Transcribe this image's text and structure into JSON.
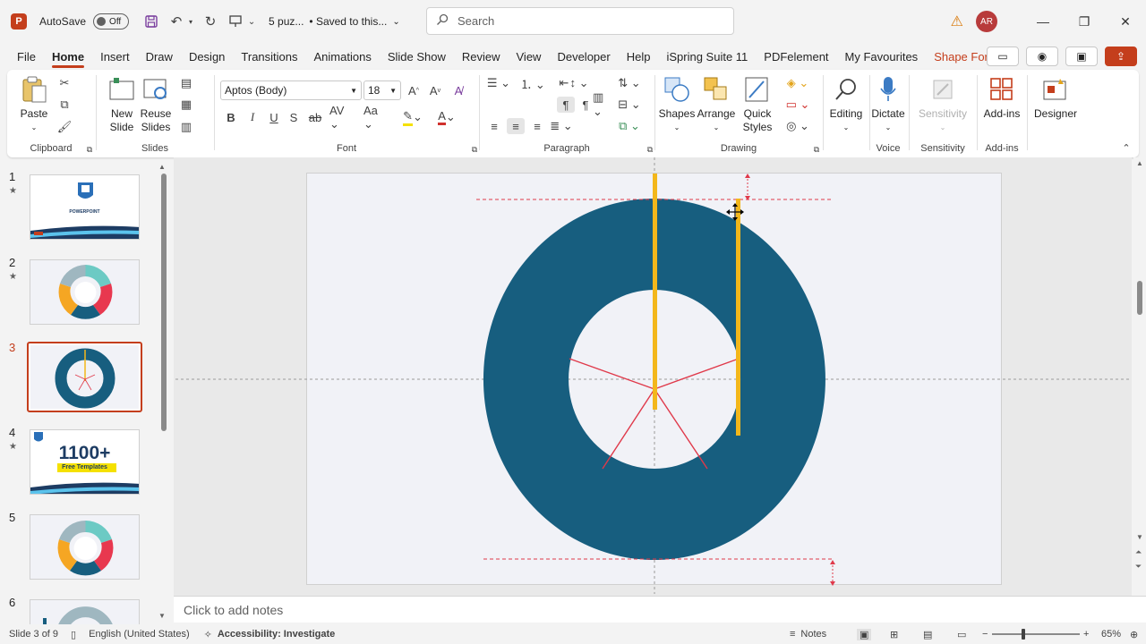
{
  "titlebar": {
    "app_logo": "P",
    "autosave_label": "AutoSave",
    "autosave_state": "Off",
    "doc_title": "5 puz...",
    "save_status": "• Saved to this...",
    "search_placeholder": "Search",
    "avatar_initials": "AR"
  },
  "menu": {
    "tabs": [
      "File",
      "Home",
      "Insert",
      "Draw",
      "Design",
      "Transitions",
      "Animations",
      "Slide Show",
      "Review",
      "View",
      "Developer",
      "Help",
      "iSpring Suite 11",
      "PDFelement",
      "My Favourites",
      "Shape Format"
    ],
    "active_tab": "Home"
  },
  "ribbon": {
    "clipboard": {
      "paste": "Paste",
      "label": "Clipboard"
    },
    "slides": {
      "new_slide": "New Slide",
      "reuse_slides": "Reuse Slides",
      "label": "Slides"
    },
    "font": {
      "font_name": "Aptos (Body)",
      "font_size": "18",
      "label": "Font"
    },
    "paragraph": {
      "label": "Paragraph"
    },
    "drawing": {
      "shapes": "Shapes",
      "arrange": "Arrange",
      "quick_styles": "Quick Styles",
      "label": "Drawing"
    },
    "editing": {
      "editing": "Editing"
    },
    "voice": {
      "dictate": "Dictate",
      "label": "Voice"
    },
    "sensitivity": {
      "sensitivity": "Sensitivity",
      "label": "Sensitivity"
    },
    "addins": {
      "addins": "Add-ins",
      "label": "Add-ins"
    },
    "designer": {
      "designer": "Designer"
    }
  },
  "thumbnails": [
    {
      "num": "1",
      "star": "★"
    },
    {
      "num": "2",
      "star": "★"
    },
    {
      "num": "3",
      "star": ""
    },
    {
      "num": "4",
      "star": "★"
    },
    {
      "num": "5",
      "star": ""
    },
    {
      "num": "6",
      "star": ""
    }
  ],
  "thumb_texts": {
    "t1_title": "POWERPOINT",
    "t4_big": "1100+",
    "t4_sub": "Free Templates"
  },
  "notes_placeholder": "Click to add notes",
  "status": {
    "slide_info": "Slide 3 of 9",
    "language": "English (United States)",
    "accessibility": "Accessibility: Investigate",
    "notes": "Notes",
    "zoom": "65%"
  },
  "colors": {
    "accent": "#c43e1c",
    "donut": "#175e7f",
    "yellow": "#f3b71b",
    "guide_red": "#e0394a"
  }
}
